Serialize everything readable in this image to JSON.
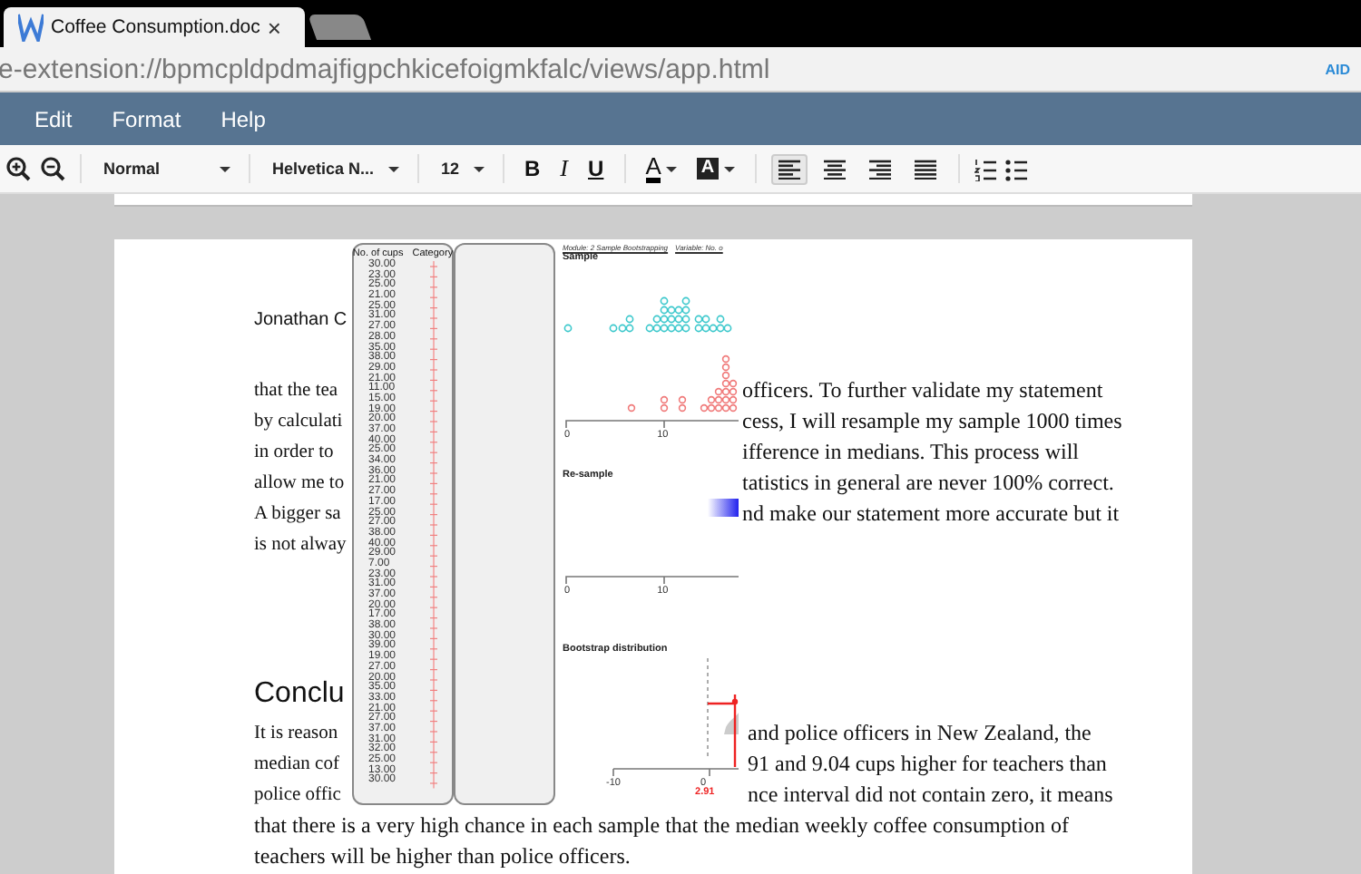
{
  "browser": {
    "tabs": [
      {
        "title": "Coffee Consumption.doc",
        "close": "×",
        "selected": true
      },
      {
        "selected": false
      }
    ],
    "url": "e-extension://bpmcpldpdmajfigpchkicefoigmkfalc/views/app.html",
    "extension_badge": "AID"
  },
  "menu": [
    "Edit",
    "Format",
    "Help"
  ],
  "toolbar": {
    "style": "Normal",
    "font": "Helvetica N...",
    "size": "12",
    "formats": [
      {
        "kind": "bold",
        "label": "B"
      },
      {
        "kind": "italic",
        "label": "I"
      },
      {
        "kind": "underline",
        "label": "U"
      }
    ],
    "text_color": "A",
    "highlight": "A",
    "alignments": [
      {
        "kind": "left",
        "selected": true
      },
      {
        "kind": "center",
        "selected": false
      },
      {
        "kind": "right",
        "selected": false
      },
      {
        "kind": "justify",
        "selected": false
      }
    ],
    "lists": [
      {
        "kind": "numbered"
      },
      {
        "kind": "bulleted"
      }
    ]
  },
  "document": {
    "author": "Jonathan C",
    "paragraph_1": [
      {
        "left": "that the tea",
        "right": "officers. To further validate my statement"
      },
      {
        "left": "by calculati",
        "right": "cess, I will resample my sample 1000 times"
      },
      {
        "left": "in order to",
        "right": "ifference in medians. This process will"
      },
      {
        "left": "allow me to",
        "right": "tatistics in general are never 100% correct."
      },
      {
        "left": "A bigger sa",
        "right": "nd make our statement more accurate but it"
      },
      {
        "left": "is not alway"
      }
    ],
    "heading": "Conclu",
    "paragraph_2": [
      {
        "left": "It is reason",
        "right": "and police officers in New Zealand, the"
      },
      {
        "left": "median cof",
        "right": "91 and 9.04 cups higher for teachers than"
      },
      {
        "left": "police offic",
        "right": "nce interval did not contain zero, it means"
      },
      {
        "left": "that there is a very high chance in each sample that the median weekly coffee consumption of"
      },
      {
        "left": "teachers will be higher than police officers."
      }
    ]
  },
  "data_panel": {
    "columns": [
      "No. of cups",
      "Category"
    ],
    "values": [
      "30.00",
      "23.00",
      "25.00",
      "21.00",
      "25.00",
      "31.00",
      "27.00",
      "28.00",
      "35.00",
      "38.00",
      "29.00",
      "21.00",
      "11.00",
      "15.00",
      "19.00",
      "20.00",
      "37.00",
      "40.00",
      "25.00",
      "34.00",
      "36.00",
      "21.00",
      "27.00",
      "17.00",
      "25.00",
      "27.00",
      "38.00",
      "40.00",
      "29.00",
      "7.00",
      "23.00",
      "31.00",
      "37.00",
      "20.00",
      "17.00",
      "38.00",
      "30.00",
      "39.00",
      "19.00",
      "27.00",
      "20.00",
      "35.00",
      "33.00",
      "21.00",
      "27.00",
      "37.00",
      "31.00",
      "32.00",
      "25.00",
      "13.00",
      "30.00"
    ]
  },
  "plot": {
    "header": "Module: 2 Sample Bootstrapping",
    "variable": "Variable: No. o",
    "panels": [
      {
        "kind": "sample",
        "title": "Sample",
        "ticks": [
          "0",
          "10"
        ]
      },
      {
        "kind": "resample",
        "title": "Re-sample",
        "ticks": [
          "0",
          "10"
        ]
      },
      {
        "kind": "bootstrap",
        "title": "Bootstrap distribution",
        "ticks": [
          "-10",
          "0"
        ],
        "marker": "2.91"
      }
    ]
  }
}
